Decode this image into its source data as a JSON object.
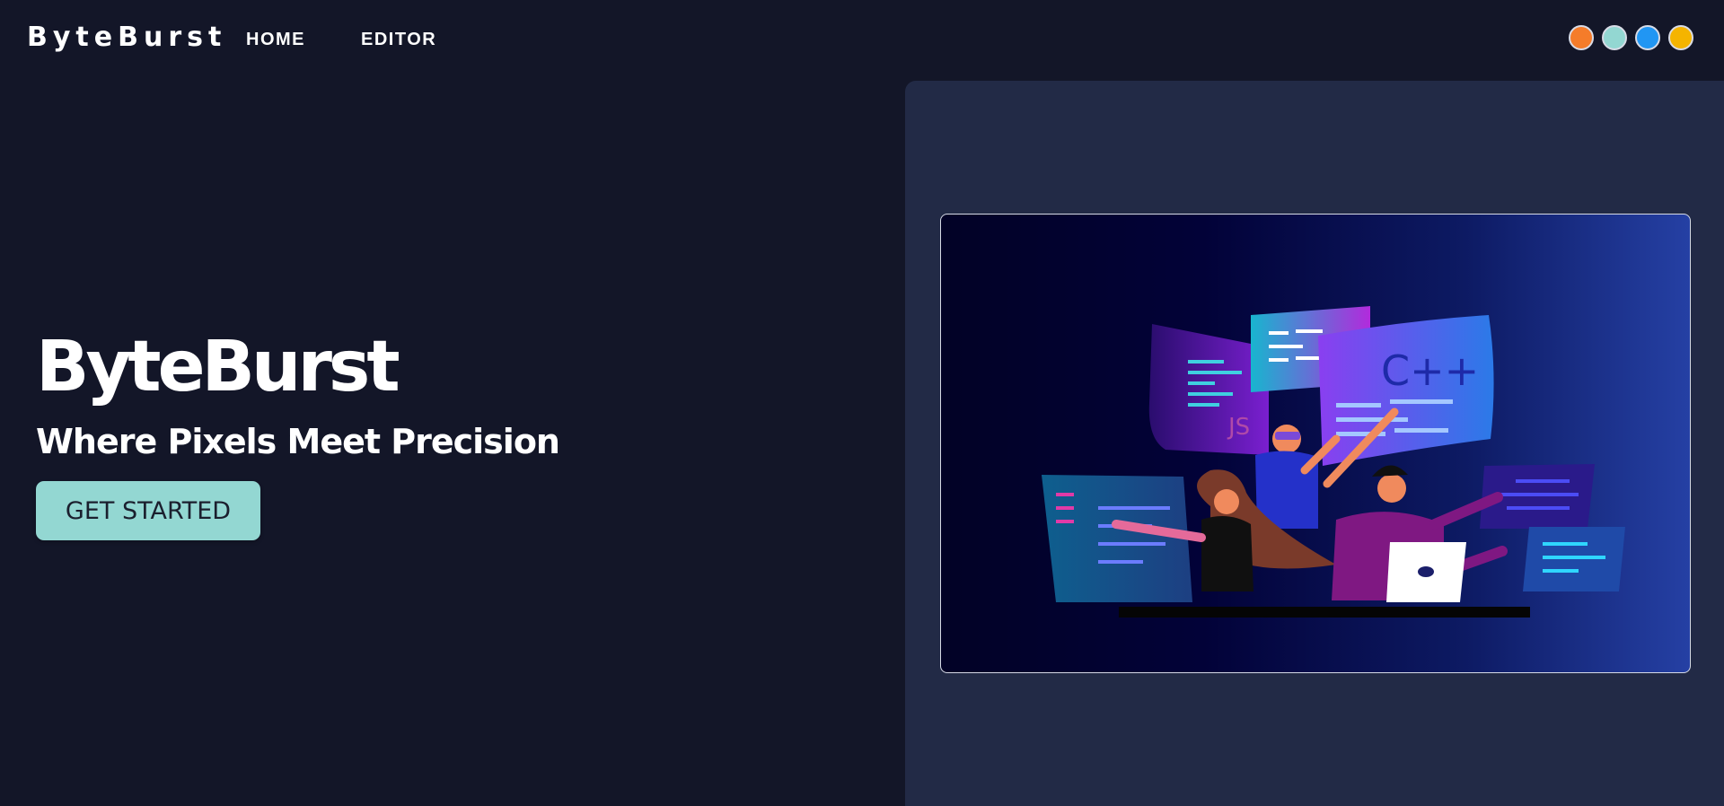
{
  "navbar": {
    "brand": "ByteBurst",
    "links": [
      "HOME",
      "EDITOR"
    ],
    "theme_swatches": [
      {
        "name": "orange",
        "color": "#f57c2a"
      },
      {
        "name": "teal",
        "color": "#93d7d2"
      },
      {
        "name": "blue",
        "color": "#2196f3"
      },
      {
        "name": "amber",
        "color": "#f5b400"
      }
    ]
  },
  "hero": {
    "title": "ByteBurst",
    "subtitle": "Where Pixels Meet Precision",
    "cta_label": "GET STARTED"
  },
  "illustration": {
    "screen_labels": [
      "C++",
      "JS"
    ]
  },
  "colors": {
    "background": "#131628",
    "panel": "#222a46",
    "accent": "#93d7d2"
  }
}
